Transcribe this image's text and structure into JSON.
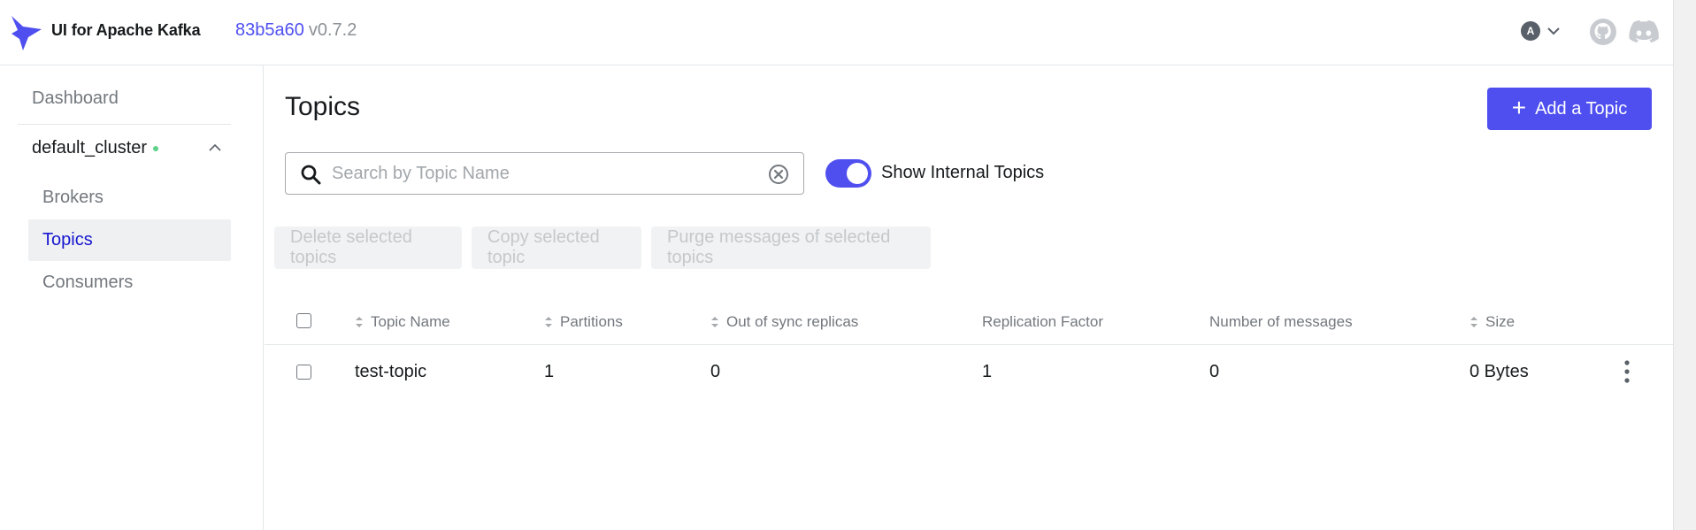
{
  "header": {
    "app_title": "UI for Apache Kafka",
    "version_hash": "83b5a60",
    "version": "v0.7.2",
    "user_initial": "A"
  },
  "sidebar": {
    "dashboard": "Dashboard",
    "cluster_name": "default_cluster",
    "cluster_status_color": "#5ed28a",
    "items": [
      {
        "label": "Brokers",
        "active": false
      },
      {
        "label": "Topics",
        "active": true
      },
      {
        "label": "Consumers",
        "active": false
      }
    ]
  },
  "main": {
    "title": "Topics",
    "add_button": "Add a Topic",
    "search_placeholder": "Search by Topic Name",
    "search_value": "",
    "show_internal_label": "Show Internal Topics",
    "show_internal_on": true,
    "bulk_actions": [
      "Delete selected topics",
      "Copy selected topic",
      "Purge messages of selected topics"
    ],
    "columns": [
      "Topic Name",
      "Partitions",
      "Out of sync replicas",
      "Replication Factor",
      "Number of messages",
      "Size"
    ],
    "rows": [
      {
        "topic_name": "test-topic",
        "partitions": "1",
        "out_of_sync": "0",
        "replication_factor": "1",
        "messages": "0",
        "size": "0 Bytes"
      }
    ]
  },
  "colors": {
    "accent": "#4f4ff0",
    "active_nav_text": "#1717cf",
    "muted_text": "#73787e"
  }
}
